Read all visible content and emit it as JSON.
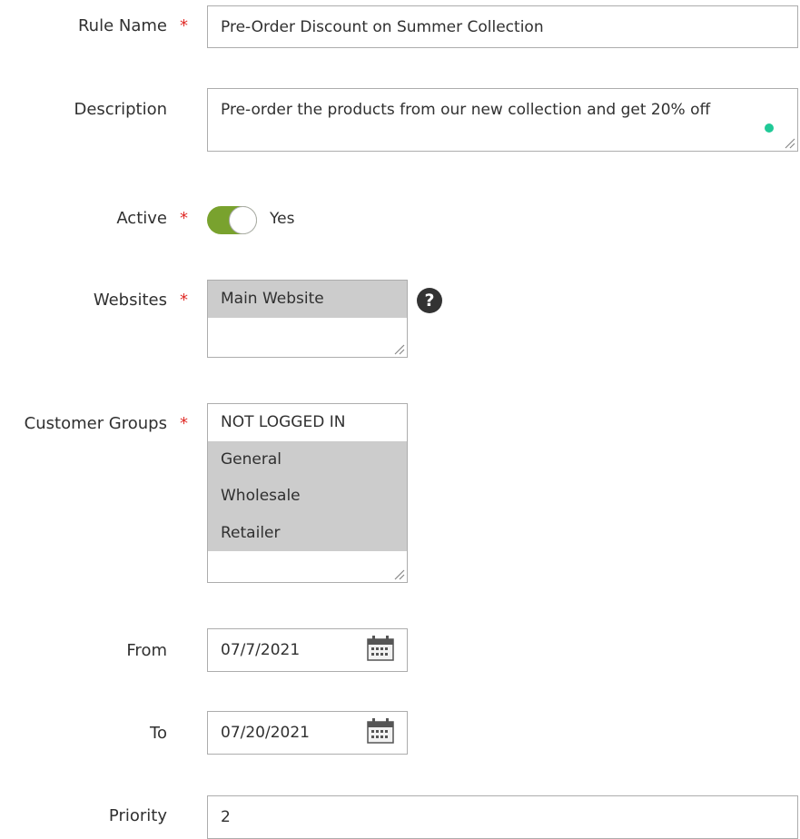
{
  "form": {
    "rule_name": {
      "label": "Rule Name",
      "value": "Pre-Order Discount on Summer Collection",
      "required": "*"
    },
    "description": {
      "label": "Description",
      "value": "Pre-order the products from our new collection and get 20% off"
    },
    "active": {
      "label": "Active",
      "required": "*",
      "state_label": "Yes",
      "on": true
    },
    "websites": {
      "label": "Websites",
      "required": "*",
      "options": [
        "Main Website"
      ],
      "help": "?"
    },
    "customer_groups": {
      "label": "Customer Groups",
      "required": "*",
      "options": [
        "NOT LOGGED IN",
        "General",
        "Wholesale",
        "Retailer"
      ]
    },
    "from": {
      "label": "From",
      "value": "07/7/2021"
    },
    "to": {
      "label": "To",
      "value": "07/20/2021"
    },
    "priority": {
      "label": "Priority",
      "value": "2"
    }
  },
  "colors": {
    "required": "#e02b27",
    "toggle_on": "#79a22e",
    "selected_option": "#cccccc",
    "grammar_dot": "#20c997"
  },
  "icons": {
    "calendar": "calendar-icon",
    "help": "help-icon",
    "resize": "resize-handle-icon"
  }
}
